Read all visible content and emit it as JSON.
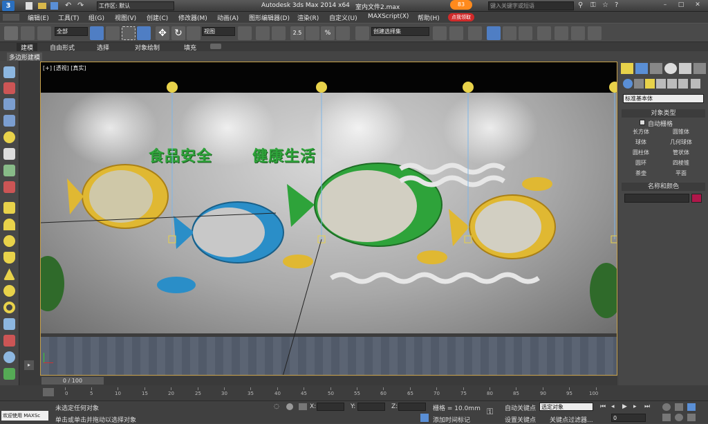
{
  "app": {
    "workspace_label": "工作区: 默认",
    "app_title": "Autodesk 3ds Max  2014 x64",
    "file_name": "室内文件2.max",
    "search_placeholder": "键入关键字或短语"
  },
  "menu": [
    "编辑(E)",
    "工具(T)",
    "组(G)",
    "视图(V)",
    "创建(C)",
    "修改器(M)",
    "动画(A)",
    "图形编辑器(D)",
    "渲染(R)",
    "自定义(U)",
    "MAXScript(X)",
    "帮助(H)"
  ],
  "toolbar": {
    "selection_filter": "全部",
    "reference_coord": "视图",
    "named_selection": "创建选择集",
    "snap_label": "2.5"
  },
  "ribbon": {
    "tabs": [
      "建模",
      "自由形式",
      "选择",
      "对象绘制",
      "填充"
    ],
    "sub_label": "多边形建模"
  },
  "viewport": {
    "label": "[+] [透视] [真实]",
    "wall_text_1": "食品安全",
    "wall_text_2": "健康生活"
  },
  "command_panel": {
    "category": "标准基本体",
    "rollout_object_type": "对象类型",
    "auto_grid": "自动栅格",
    "primitives": [
      "长方体",
      "圆锥体",
      "球体",
      "几何球体",
      "圆柱体",
      "管状体",
      "圆环",
      "四棱锥",
      "茶壶",
      "平面"
    ],
    "rollout_name_color": "名称和颜色",
    "name_color_hex": "#b0174a"
  },
  "timeline": {
    "frame_display": "0 / 100",
    "ticks": [
      "0",
      "5",
      "10",
      "15",
      "20",
      "25",
      "30",
      "35",
      "40",
      "45",
      "50",
      "55",
      "60",
      "65",
      "70",
      "75",
      "80",
      "85",
      "90",
      "95",
      "100"
    ]
  },
  "status": {
    "maxscript_label": "欢迎使用  MAXSc",
    "selection_msg": "未选定任何对象",
    "prompt_msg": "单击或单击并拖动以选择对象",
    "x_label": "X:",
    "y_label": "Y:",
    "z_label": "Z:",
    "grid": "栅格 = 10.0mm",
    "add_time_tag": "添加时间标记",
    "auto_key": "自动关键点",
    "selected_obj": "选定对象",
    "set_key": "设置关键点",
    "key_filters": "关键点过滤器...",
    "frame_field": "0",
    "ad_badge": "83",
    "ad_text": "点我领取"
  },
  "colors": {
    "accent_yellow": "#e0b832",
    "fish_green": "#2ea33a",
    "fish_blue": "#2a8ec8",
    "viewport_border": "#c9a24a",
    "name_color": "#b0174a"
  }
}
